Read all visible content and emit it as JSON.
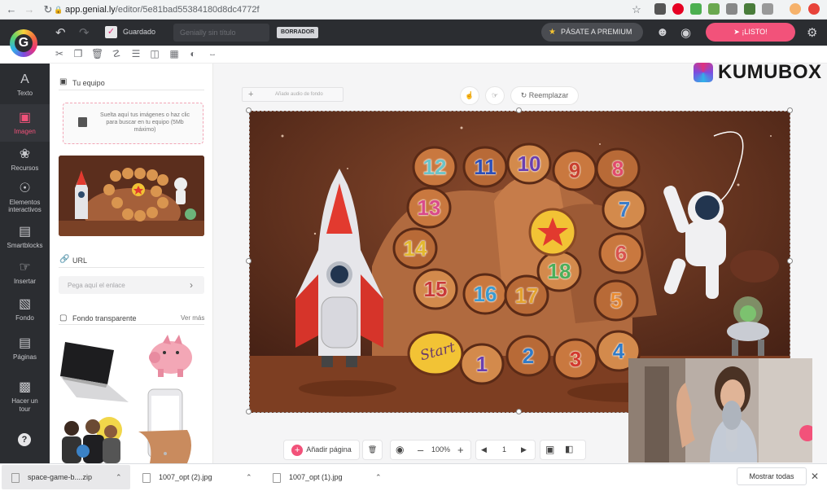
{
  "browser": {
    "url_host": "app.genial.ly",
    "url_path": "/editor/5e81bad55384180d8dc4772f"
  },
  "topbar": {
    "saved_label": "Guardado",
    "title_placeholder": "Genially sin título",
    "draft_badge": "BORRADOR",
    "premium_label": "PÁSATE A PREMIUM",
    "listo_label": "¡LISTO!"
  },
  "rail": {
    "items": [
      {
        "label": "Texto",
        "icon": "text-icon"
      },
      {
        "label": "Imagen",
        "icon": "image-icon"
      },
      {
        "label": "Recursos",
        "icon": "resources-icon"
      },
      {
        "label": "Elementos interactivos",
        "icon": "interactive-icon"
      },
      {
        "label": "Smartblocks",
        "icon": "smartblocks-icon"
      },
      {
        "label": "Insertar",
        "icon": "insert-icon"
      },
      {
        "label": "Fondo",
        "icon": "background-icon"
      },
      {
        "label": "Páginas",
        "icon": "pages-icon"
      },
      {
        "label": "Hacer un tour",
        "icon": "tour-icon"
      }
    ],
    "active": "Imagen"
  },
  "panel": {
    "team_title": "Tu equipo",
    "drop_text": "Suelta aquí tus imágenes o haz clic para buscar en tu equipo (5Mb máximo)",
    "url_title": "URL",
    "url_placeholder": "Pega aquí el enlace",
    "transparent_title": "Fondo transparente",
    "see_more": "Ver más"
  },
  "canvas": {
    "audio_label": "Añade audio de fondo",
    "replace_label": "Reemplazar",
    "add_page": "Añadir página",
    "zoom": "100%",
    "page_number": "1"
  },
  "board": {
    "numbers": [
      "12",
      "11",
      "10",
      "9",
      "8",
      "7",
      "6",
      "5",
      "4",
      "3",
      "2",
      "1",
      "13",
      "14",
      "15",
      "16",
      "17",
      "18"
    ],
    "start_label": "Start"
  },
  "watermark": "KUMUBOX",
  "downloads": {
    "items": [
      "space-game-b....zip",
      "1007_opt (2).jpg",
      "1007_opt (1).jpg"
    ],
    "show_all": "Mostrar todas"
  },
  "colors": {
    "accent": "#f2527a",
    "dark": "#2b2d31"
  }
}
